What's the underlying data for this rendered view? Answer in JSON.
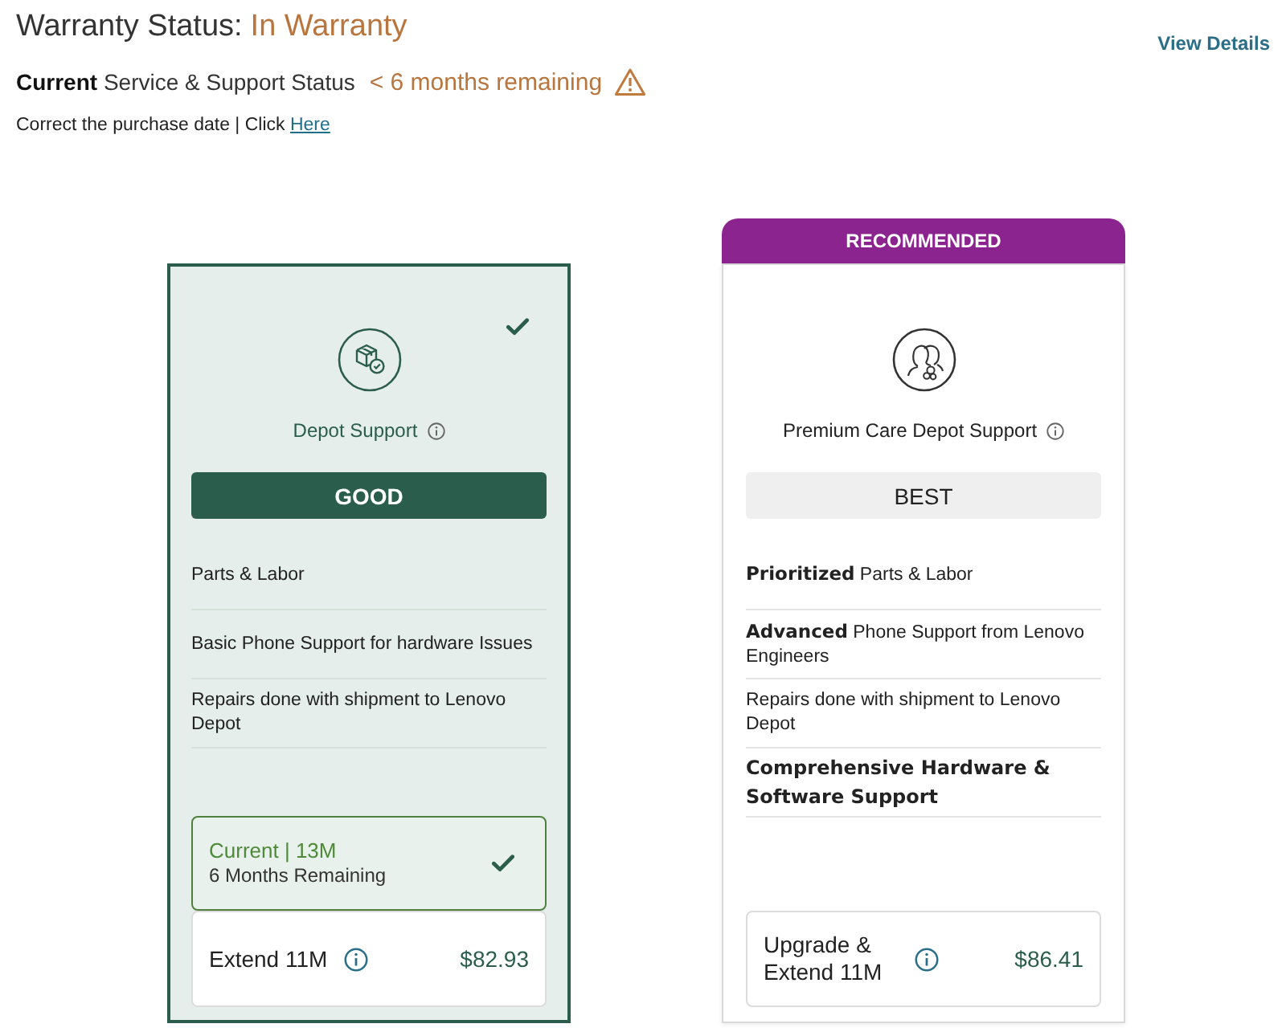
{
  "warranty": {
    "label": "Warranty Status:",
    "value": "In Warranty"
  },
  "view_details": "View Details",
  "support_status": {
    "label": "**Current** Service & Support Status",
    "remaining": "< 6 months remaining"
  },
  "purchase_note": {
    "text": "Correct the purchase date | Click",
    "link": "Here"
  },
  "cards": [
    {
      "kind": "depot",
      "name": "Depot Support",
      "tier": "GOOD",
      "selected": true,
      "features": [
        {
          "text": "Parts & Labor",
          "bold": false
        },
        {
          "text": "Basic Phone Support for hardware Issues",
          "bold": false
        },
        {
          "text": "Repairs done with shipment to Lenovo Depot",
          "bold": false
        }
      ],
      "options": [
        {
          "kind": "current",
          "title": "Current | 13M",
          "subtitle": "6 Months Remaining",
          "selected": true
        },
        {
          "kind": "offer",
          "label": "Extend 11M",
          "price": "$82.93",
          "selected": false
        }
      ]
    },
    {
      "kind": "premium",
      "badge": "RECOMMENDED",
      "name": "Premium Care Depot Support",
      "tier": "BEST",
      "selected": false,
      "features": [
        {
          "text": "**Prioritized** Parts & Labor",
          "bold": false
        },
        {
          "text": "**Advanced** Phone Support from Lenovo Engineers",
          "bold": false
        },
        {
          "text": "Repairs done with shipment to Lenovo Depot",
          "bold": false
        },
        {
          "text": "Comprehensive Hardware & Software Support",
          "bold": true
        }
      ],
      "options": [
        {
          "kind": "offer",
          "label": "Upgrade & Extend 11M",
          "price": "$86.41",
          "selected": false
        }
      ]
    }
  ]
}
